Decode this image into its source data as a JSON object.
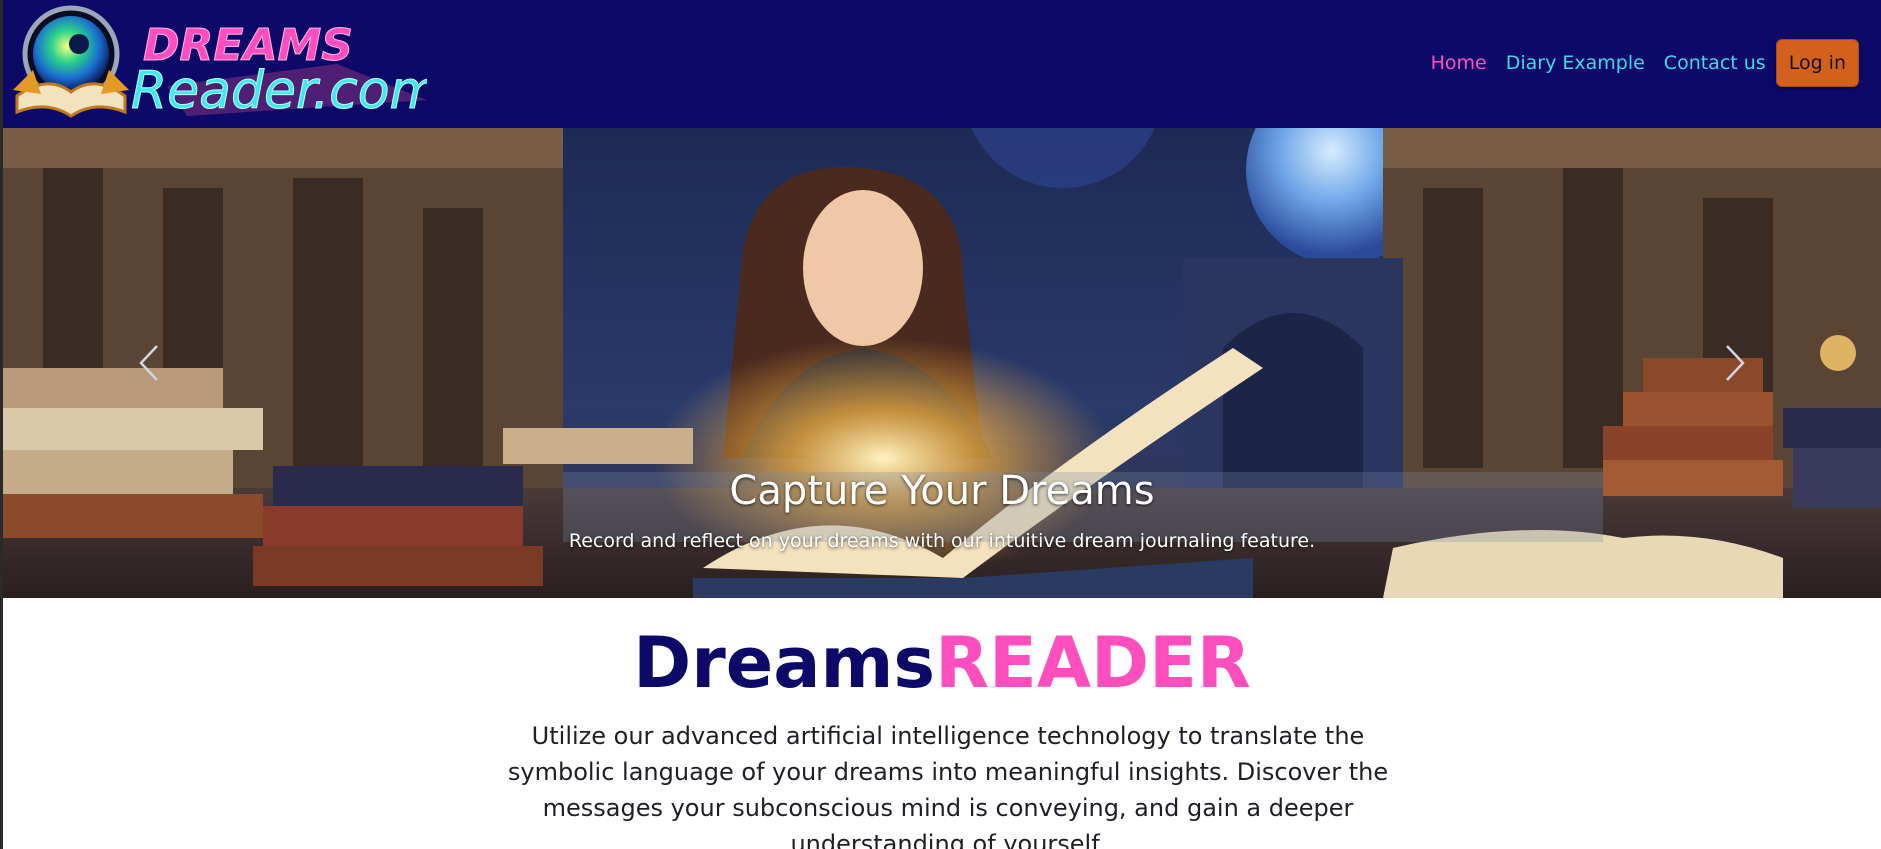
{
  "brand": {
    "logo_text_top": "DREAMS",
    "logo_text_bottom": "Reader.com"
  },
  "nav": {
    "items": [
      {
        "label": "Home",
        "active": true
      },
      {
        "label": "Diary Example",
        "active": false
      },
      {
        "label": "Contact us",
        "active": false
      }
    ],
    "login_label": "Log in"
  },
  "carousel": {
    "prev_icon": "chevron-left-icon",
    "next_icon": "chevron-right-icon",
    "slide_title": "Capture Your Dreams",
    "slide_text": "Record and reflect on your dreams with our intuitive dream journaling feature."
  },
  "main": {
    "headline_part1": "Dreams",
    "headline_part2": "READER",
    "intro_lines": [
      "Utilize our advanced artificial intelligence technology to translate the",
      "symbolic language of your dreams into meaningful insights. Discover the",
      "messages your subconscious mind is conveying, and gain a deeper",
      "understanding of yourself."
    ]
  },
  "colors": {
    "navbar_bg": "#0c0968",
    "link": "#40d8e6",
    "link_active": "#ff4fbf",
    "login_bg": "#d4611b",
    "headline_dark": "#0c0968",
    "headline_pink": "#ff4fbf"
  }
}
